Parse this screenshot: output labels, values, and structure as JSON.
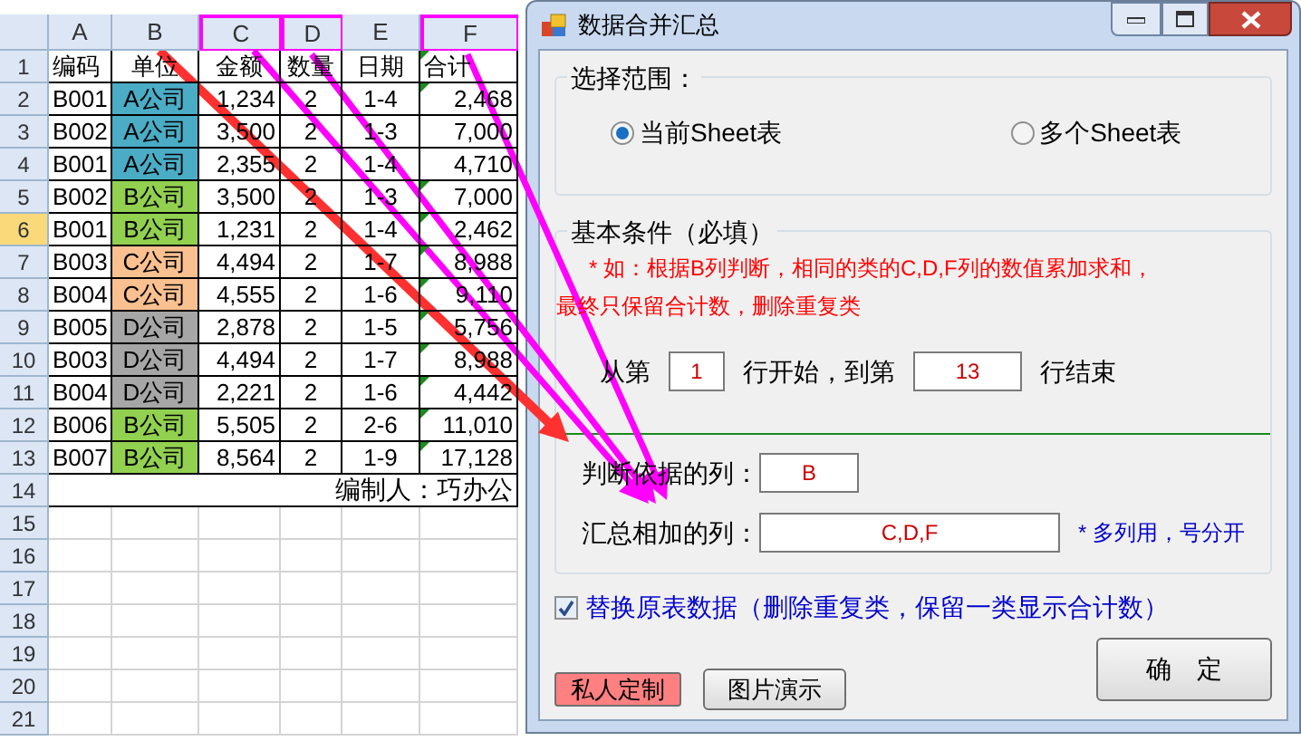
{
  "spreadsheet": {
    "columns": [
      {
        "label": "A",
        "highlighted": false
      },
      {
        "label": "B",
        "highlighted": false
      },
      {
        "label": "C",
        "highlighted": true
      },
      {
        "label": "D",
        "highlighted": true
      },
      {
        "label": "E",
        "highlighted": false
      },
      {
        "label": "F",
        "highlighted": true
      }
    ],
    "rows": [
      {
        "number": "1",
        "selected": false,
        "kind": "header",
        "cells": [
          "编码",
          "单位",
          "金额",
          "数量",
          "日期",
          "合计"
        ],
        "flag": true
      },
      {
        "number": "2",
        "selected": false,
        "kind": "data",
        "cells": [
          "B001",
          "A公司",
          "1,234",
          "2",
          "1-4",
          "2,468"
        ],
        "color": "#4bacc6",
        "flag": true
      },
      {
        "number": "3",
        "selected": false,
        "kind": "data",
        "cells": [
          "B002",
          "A公司",
          "3,500",
          "2",
          "1-3",
          "7,000"
        ],
        "color": "#4bacc6",
        "flag": false
      },
      {
        "number": "4",
        "selected": false,
        "kind": "data",
        "cells": [
          "B001",
          "A公司",
          "2,355",
          "2",
          "1-4",
          "4,710"
        ],
        "color": "#4bacc6",
        "flag": false
      },
      {
        "number": "5",
        "selected": false,
        "kind": "data",
        "cells": [
          "B002",
          "B公司",
          "3,500",
          "2",
          "1-3",
          "7,000"
        ],
        "color": "#92d050",
        "flag": true
      },
      {
        "number": "6",
        "selected": true,
        "kind": "data",
        "cells": [
          "B001",
          "B公司",
          "1,231",
          "2",
          "1-4",
          "2,462"
        ],
        "color": "#92d050",
        "flag": true
      },
      {
        "number": "7",
        "selected": false,
        "kind": "data",
        "cells": [
          "B003",
          "C公司",
          "4,494",
          "2",
          "1-7",
          "8,988"
        ],
        "color": "#fac090",
        "flag": true
      },
      {
        "number": "8",
        "selected": false,
        "kind": "data",
        "cells": [
          "B004",
          "C公司",
          "4,555",
          "2",
          "1-6",
          "9,110"
        ],
        "color": "#fac090",
        "flag": true
      },
      {
        "number": "9",
        "selected": false,
        "kind": "data",
        "cells": [
          "B005",
          "D公司",
          "2,878",
          "2",
          "1-5",
          "5,756"
        ],
        "color": "#a6a6a6",
        "flag": true
      },
      {
        "number": "10",
        "selected": false,
        "kind": "data",
        "cells": [
          "B003",
          "D公司",
          "4,494",
          "2",
          "1-7",
          "8,988"
        ],
        "color": "#a6a6a6",
        "flag": true
      },
      {
        "number": "11",
        "selected": false,
        "kind": "data",
        "cells": [
          "B004",
          "D公司",
          "2,221",
          "2",
          "1-6",
          "4,442"
        ],
        "color": "#a6a6a6",
        "flag": true
      },
      {
        "number": "12",
        "selected": false,
        "kind": "data",
        "cells": [
          "B006",
          "B公司",
          "5,505",
          "2",
          "2-6",
          "11,010"
        ],
        "color": "#92d050",
        "flag": true
      },
      {
        "number": "13",
        "selected": false,
        "kind": "data",
        "cells": [
          "B007",
          "B公司",
          "8,564",
          "2",
          "1-9",
          "17,128"
        ],
        "color": "#92d050",
        "flag": true
      },
      {
        "number": "14",
        "selected": false,
        "kind": "footer",
        "text": "编制人：巧办公"
      },
      {
        "number": "15",
        "selected": false,
        "kind": "empty"
      },
      {
        "number": "16",
        "selected": false,
        "kind": "empty"
      },
      {
        "number": "17",
        "selected": false,
        "kind": "empty"
      },
      {
        "number": "18",
        "selected": false,
        "kind": "empty"
      },
      {
        "number": "19",
        "selected": false,
        "kind": "empty"
      },
      {
        "number": "20",
        "selected": false,
        "kind": "empty"
      },
      {
        "number": "21",
        "selected": false,
        "kind": "empty"
      }
    ]
  },
  "dialog": {
    "title": "数据合并汇总",
    "range_group": {
      "title": "选择范围：",
      "options": [
        {
          "label": "当前Sheet表",
          "selected": true
        },
        {
          "label": "多个Sheet表",
          "selected": false
        }
      ]
    },
    "conditions_group": {
      "title": "基本条件（必填）",
      "note_lines": [
        "* 如：根据B列判断，相同的类的C,D,F列的数值累加求和，",
        "最终只保留合计数，删除重复类"
      ],
      "start_label": "从第",
      "start_value": "1",
      "middle_label": "行开始，到第",
      "end_value": "13",
      "end_label": "行结束",
      "key_label": "判断依据的列：",
      "key_value": "B",
      "sum_label": "汇总相加的列：",
      "sum_value": "C,D,F",
      "sum_hint": "* 多列用，号分开"
    },
    "replace_checkbox": {
      "label": "替换原表数据（删除重复类，保留一类显示合计数）",
      "checked": true
    },
    "buttons": [
      {
        "label": "私人定制",
        "kind": "custom"
      },
      {
        "label": "图片演示",
        "kind": "normal"
      },
      {
        "label": "确　定",
        "kind": "primary"
      }
    ]
  }
}
